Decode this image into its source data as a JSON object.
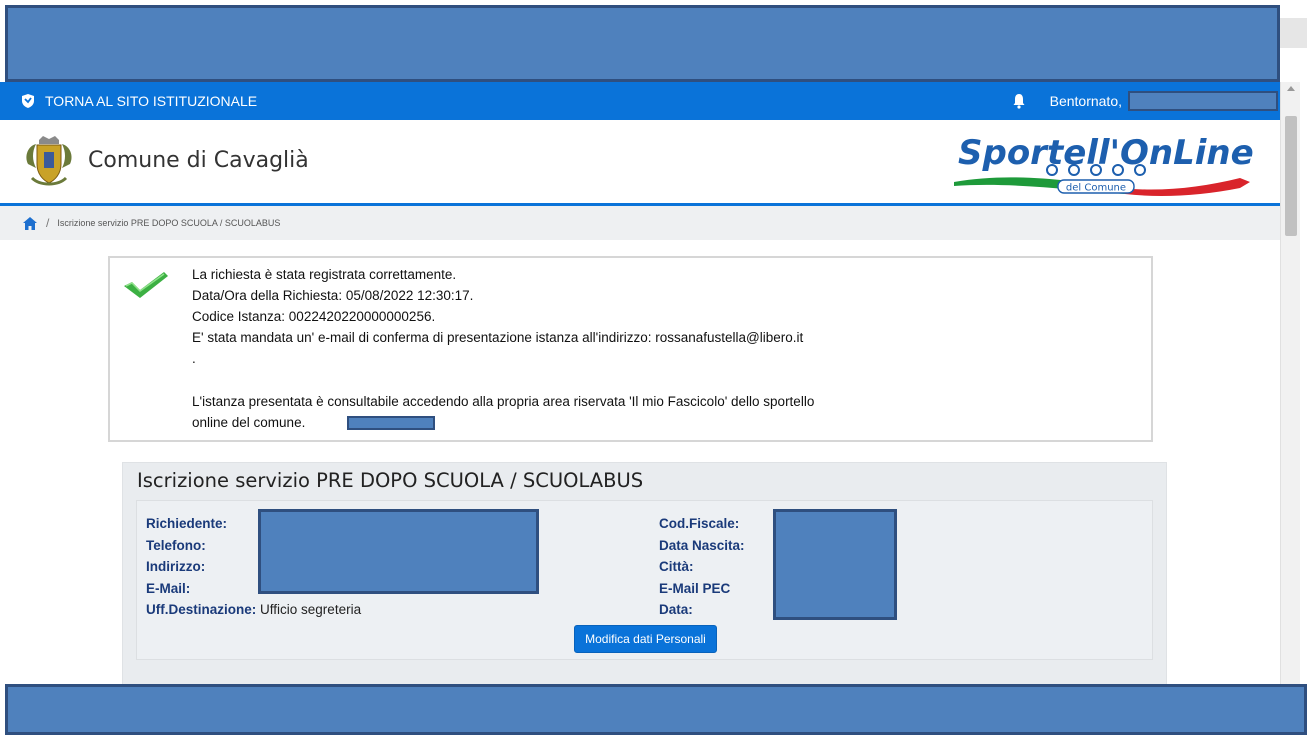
{
  "top_bar": {
    "back_link": "TORNA AL SITO ISTITUZIONALE",
    "welcome": "Bentornato,"
  },
  "header": {
    "municipality": "Comune di Cavaglià",
    "logo_text": "Sportell'OnLine",
    "logo_sub": "del Comune"
  },
  "breadcrumb": {
    "current": "Iscrizione servizio PRE DOPO SCUOLA / SCUOLABUS"
  },
  "success": {
    "line1": "La richiesta è stata registrata correttamente.",
    "line2": "Data/Ora della Richiesta: 05/08/2022 12:30:17.",
    "line3": "Codice Istanza: 0022420220000000256.",
    "line4": "E' stata mandata un' e-mail di conferma di presentazione istanza all'indirizzo: rossanafustella@libero.it",
    "line5": ".",
    "line6": "L'istanza presentata è consultabile accedendo alla propria area riservata 'Il mio Fascicolo' dello sportello",
    "line7": "online del comune."
  },
  "form": {
    "title": "Iscrizione servizio PRE DOPO SCUOLA / SCUOLABUS",
    "left_fields": [
      {
        "label": "Richiedente:",
        "value": ""
      },
      {
        "label": "Telefono:",
        "value": ""
      },
      {
        "label": "Indirizzo:",
        "value": ""
      },
      {
        "label": "E-Mail:",
        "value": ""
      },
      {
        "label": "Uff.Destinazione:",
        "value": "Ufficio segreteria"
      }
    ],
    "right_fields": [
      {
        "label": "Cod.Fiscale:",
        "value": ""
      },
      {
        "label": "Data Nascita:",
        "value": ""
      },
      {
        "label": "Città:",
        "value": ""
      },
      {
        "label": "E-Mail PEC",
        "value": ""
      },
      {
        "label": "Data:",
        "value": ""
      }
    ],
    "edit_button": "Modifica dati Personali"
  },
  "colors": {
    "primary": "#0a73d9",
    "redaction": "#4f81bd",
    "label": "#1a3a7a",
    "success_check": "#3cb043"
  }
}
